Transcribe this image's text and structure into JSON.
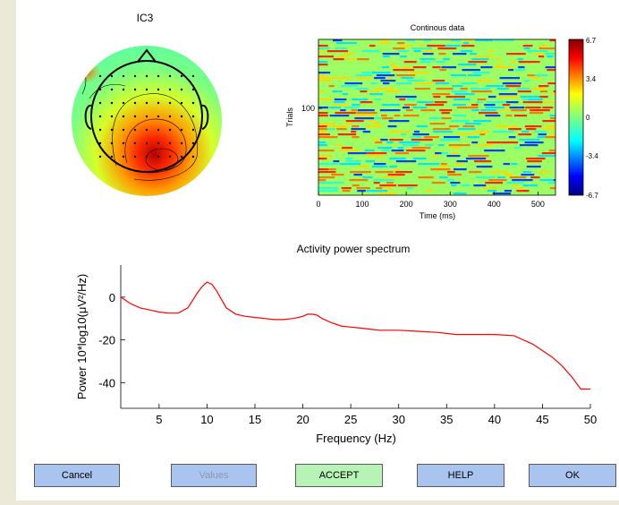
{
  "topo": {
    "title": "IC3"
  },
  "image_plot": {
    "title": "Continous data",
    "ylabel": "Trials",
    "xlabel": "Time (ms)",
    "yticks": [
      "100"
    ],
    "xticks": [
      "0",
      "100",
      "200",
      "300",
      "400",
      "500"
    ],
    "colorbar_ticks": [
      "6.7",
      "3.4",
      "0",
      "-3.4",
      "-6.7"
    ]
  },
  "chart_data": {
    "type": "line",
    "title": "Activity power spectrum",
    "xlabel": "Frequency (Hz)",
    "ylabel": "Power 10*log10(μV²/Hz)",
    "xlim": [
      1,
      50
    ],
    "ylim": [
      -52,
      15
    ],
    "xticks": [
      5,
      10,
      15,
      20,
      25,
      30,
      35,
      40,
      45,
      50
    ],
    "yticks": [
      0,
      -20,
      -40
    ],
    "series": [
      {
        "color": "#ff0000",
        "x": [
          1,
          2,
          3,
          4,
          5,
          6,
          7,
          8,
          9,
          9.5,
          10,
          10.5,
          11,
          12,
          13,
          14,
          15,
          16,
          17,
          18,
          19,
          20,
          20.5,
          21,
          21.5,
          22,
          23,
          24,
          25,
          26,
          27,
          28,
          30,
          32,
          34,
          35,
          36,
          38,
          40,
          42,
          44,
          45,
          46,
          47,
          48,
          49,
          50
        ],
        "values": [
          0,
          -3,
          -5,
          -6,
          -7,
          -7.5,
          -7.5,
          -5,
          2,
          5,
          7,
          6,
          3,
          -5,
          -8,
          -9,
          -9.5,
          -10,
          -10.5,
          -10.5,
          -10,
          -9,
          -8,
          -8,
          -8.5,
          -10,
          -12,
          -13.5,
          -14,
          -14.5,
          -15,
          -15.5,
          -15.5,
          -16,
          -16.5,
          -17,
          -17.5,
          -17.5,
          -17.5,
          -18,
          -22,
          -25,
          -28,
          -32,
          -37,
          -43,
          -43
        ]
      }
    ]
  },
  "buttons": {
    "cancel": "Cancel",
    "values": "Values",
    "accept": "ACCEPT",
    "help": "HELP",
    "ok": "OK"
  },
  "colors": {
    "button_blue": "#a9c4ee",
    "button_green": "#b7f2b7",
    "line": "#ff0000"
  }
}
